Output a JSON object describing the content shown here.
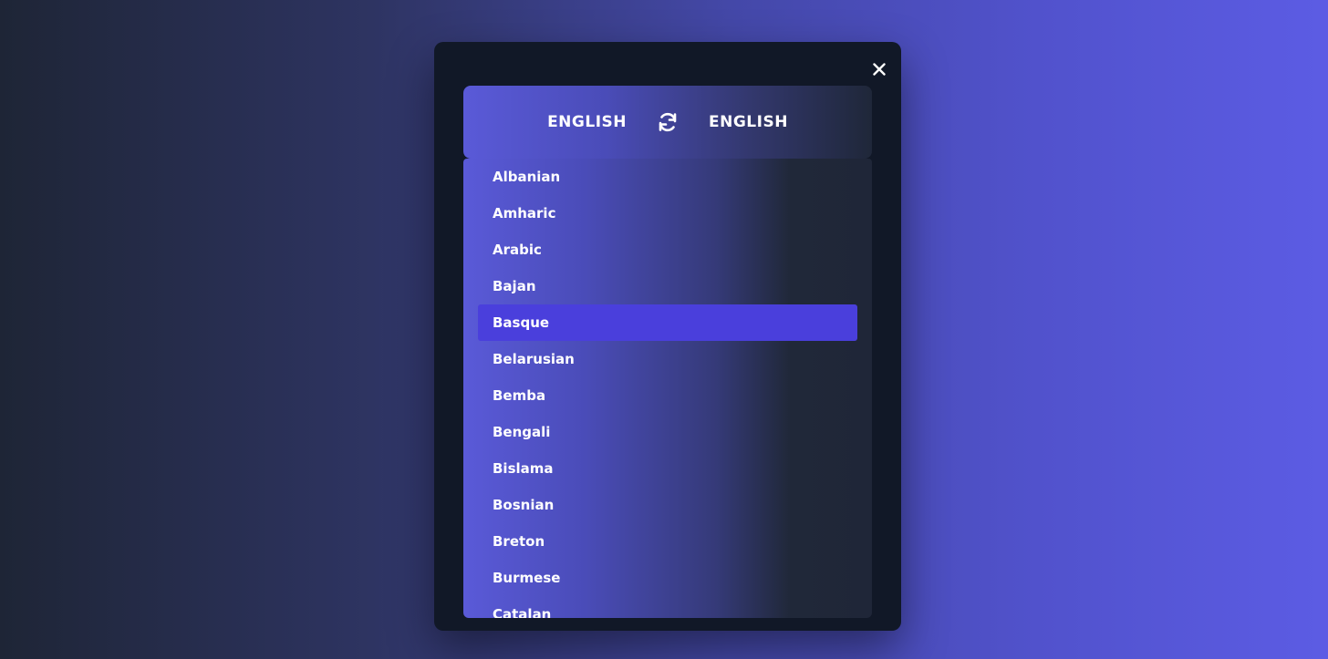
{
  "header": {
    "source_language": "ENGLISH",
    "target_language": "ENGLISH"
  },
  "icons": {
    "close": "close-icon",
    "swap": "swap-arrows-icon"
  },
  "languages": [
    {
      "label": "Albanian",
      "selected": false
    },
    {
      "label": "Amharic",
      "selected": false
    },
    {
      "label": "Arabic",
      "selected": false
    },
    {
      "label": "Bajan",
      "selected": false
    },
    {
      "label": "Basque",
      "selected": true
    },
    {
      "label": "Belarusian",
      "selected": false
    },
    {
      "label": "Bemba",
      "selected": false
    },
    {
      "label": "Bengali",
      "selected": false
    },
    {
      "label": "Bislama",
      "selected": false
    },
    {
      "label": "Bosnian",
      "selected": false
    },
    {
      "label": "Breton",
      "selected": false
    },
    {
      "label": "Burmese",
      "selected": false
    },
    {
      "label": "Catalan",
      "selected": false
    }
  ],
  "colors": {
    "modal_bg": "#111827",
    "selected_item": "#4a3fdc",
    "accent": "#5c5ce4"
  }
}
